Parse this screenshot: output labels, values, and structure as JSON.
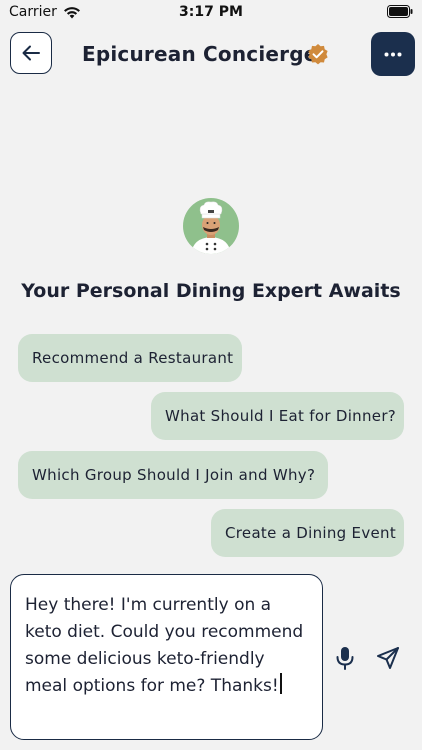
{
  "status_bar": {
    "carrier": "Carrier",
    "time": "3:17 PM"
  },
  "header": {
    "title": "Epicurean Concierge"
  },
  "intro": {
    "tagline": "Your Personal Dining Expert Awaits"
  },
  "suggestions": [
    "Recommend a Restaurant",
    "What Should I Eat for Dinner?",
    "Which Group Should I Join and Why?",
    "Create a Dining Event"
  ],
  "composer": {
    "text": "Hey there! I'm currently on a keto diet. Could you recommend some delicious keto-friendly meal options for me? Thanks!"
  },
  "colors": {
    "primary": "#1b2f4d",
    "chip_bg": "#cfe0d1",
    "verified_badge": "#d08a3c",
    "avatar_bg": "#8fc08c"
  },
  "icons": [
    "wifi-icon",
    "battery-icon",
    "back-arrow-icon",
    "verified-badge-icon",
    "more-dots-icon",
    "chef-avatar-icon",
    "microphone-icon",
    "send-icon"
  ]
}
